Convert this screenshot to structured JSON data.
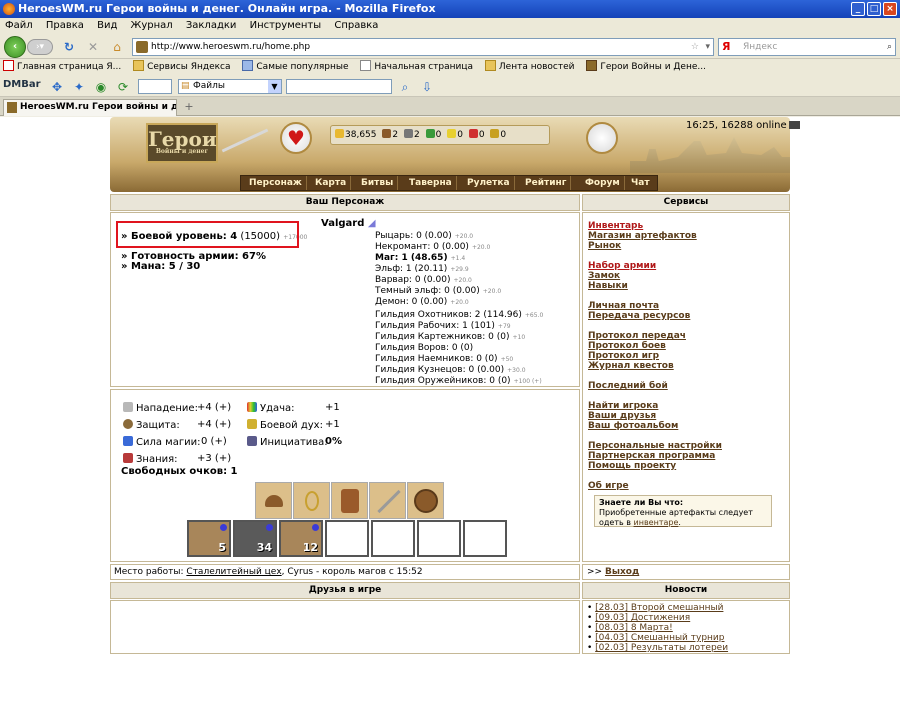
{
  "window": {
    "title": "HeroesWM.ru Герои войны и денег. Онлайн игра. - Mozilla Firefox",
    "min": "_",
    "max": "□",
    "close": "×"
  },
  "menu": [
    "Файл",
    "Правка",
    "Вид",
    "Журнал",
    "Закладки",
    "Инструменты",
    "Справка"
  ],
  "nav": {
    "url": "http://www.heroeswm.ru/home.php",
    "search_placeholder": "Яндекс",
    "yandex_mark": "Я"
  },
  "bookmarks": [
    "Главная страница Я...",
    "Сервисы Яндекса",
    "Самые популярные",
    "Начальная страница",
    "Лента новостей",
    "Герои Войны и Дене..."
  ],
  "dmbar": {
    "label": "DMBar",
    "select_value": "Файлы"
  },
  "tab": {
    "label": "HeroesWM.ru Герои войны и денег. ...",
    "new": "+"
  },
  "header": {
    "logo_big": "Герои",
    "logo_small": "Войны и денег",
    "resources": [
      "38,655",
      "2",
      "2",
      "0",
      "0",
      "0",
      "0"
    ],
    "online": "16:25, 16288 online"
  },
  "mainnav": [
    "Персонаж",
    "Карта",
    "Битвы",
    "Таверна",
    "Рулетка",
    "Рейтинг",
    "Форум",
    "Чат"
  ],
  "character": {
    "section_title": "Ваш Персонаж",
    "name": "Valgard",
    "combat_label": "» Боевой уровень: 4",
    "combat_exp": "(15000)",
    "combat_next": "+17000",
    "army_ready": "» Готовность армии: 67%",
    "mana": "» Мана: 5 / 30",
    "factions": [
      {
        "label": "Рыцарь: 0 (0.00)",
        "bonus": "+20.0"
      },
      {
        "label": "Некромант: 0 (0.00)",
        "bonus": "+20.0"
      },
      {
        "label": "Маг: 1 (48.65)",
        "bonus": "+1.4"
      },
      {
        "label": "Эльф: 1 (20.11)",
        "bonus": "+29.9"
      },
      {
        "label": "Варвар: 0 (0.00)",
        "bonus": "+20.0"
      },
      {
        "label": "Темный эльф: 0 (0.00)",
        "bonus": "+20.0"
      },
      {
        "label": "Демон: 0 (0.00)",
        "bonus": "+20.0"
      }
    ],
    "guilds": [
      {
        "label": "Гильдия Охотников: 2 (114.96)",
        "bonus": "+65.0"
      },
      {
        "label": "Гильдия Рабочих: 1 (101)",
        "bonus": "+79"
      },
      {
        "label": "Гильдия Картежников: 0 (0)",
        "bonus": "+10"
      },
      {
        "label": "Гильдия Воров: 0 (0)",
        "bonus": ""
      },
      {
        "label": "Гильдия Наемников: 0 (0)",
        "bonus": "+50"
      },
      {
        "label": "Гильдия Кузнецов: 0 (0.00)",
        "bonus": "+30.0"
      },
      {
        "label": "Гильдия Оружейников: 0 (0)",
        "bonus": "+100 (+)"
      }
    ]
  },
  "stats": {
    "attack": {
      "label": "Нападение:",
      "value": "+4 (+)"
    },
    "defense": {
      "label": "Защита:",
      "value": "+4 (+)"
    },
    "power": {
      "label": "Сила магии:",
      "value": "0 (+)"
    },
    "knowledge": {
      "label": "Знания:",
      "value": "+3 (+)"
    },
    "luck": {
      "label": "Удача:",
      "value": "+1"
    },
    "morale": {
      "label": "Боевой дух:",
      "value": "+1"
    },
    "initiative": {
      "label": "Инициатива:",
      "value": "0%"
    },
    "free": "Свободных очков: 1"
  },
  "army": [
    "5",
    "34",
    "12",
    "",
    "",
    "",
    ""
  ],
  "workplace": {
    "prefix": "Место работы:",
    "place": "Сталелитейный цех",
    "suffix": ", Cyrus - король магов с 15:52"
  },
  "friends_title": "Друзья в игре",
  "services": {
    "title": "Сервисы",
    "groups": [
      [
        "Инвентарь",
        "Магазин артефактов",
        "Рынок"
      ],
      [
        "Набор армии",
        "Замок",
        "Навыки"
      ],
      [
        "Личная почта",
        "Передача ресурсов"
      ],
      [
        "Протокол передач",
        "Протокол боев",
        "Протокол игр",
        "Журнал квестов"
      ],
      [
        "Последний бой"
      ],
      [
        "Найти игрока",
        "Ваши друзья",
        "Ваш фотоальбом"
      ],
      [
        "Персональные настройки",
        "Партнерская программа",
        "Помощь проекту"
      ],
      [
        "Об игре"
      ]
    ],
    "tip_title": "Знаете ли Вы что:",
    "tip_text": "Приобретенные артефакты следует одеть в",
    "tip_link": "инвентаре",
    "exit": "Выход",
    "exit_prefix": ">>"
  },
  "news": {
    "title": "Новости",
    "items": [
      "[28.03] Второй смешанный",
      "[09.03] Достижения",
      "[08.03] 8 Марта!",
      "[04.03] Смешанный турнир",
      "[02.03] Результаты лотереи"
    ]
  },
  "colors": {
    "accent": "#5a3c1a",
    "highlight": "#e0141e",
    "panel": "#e9e5d8"
  }
}
